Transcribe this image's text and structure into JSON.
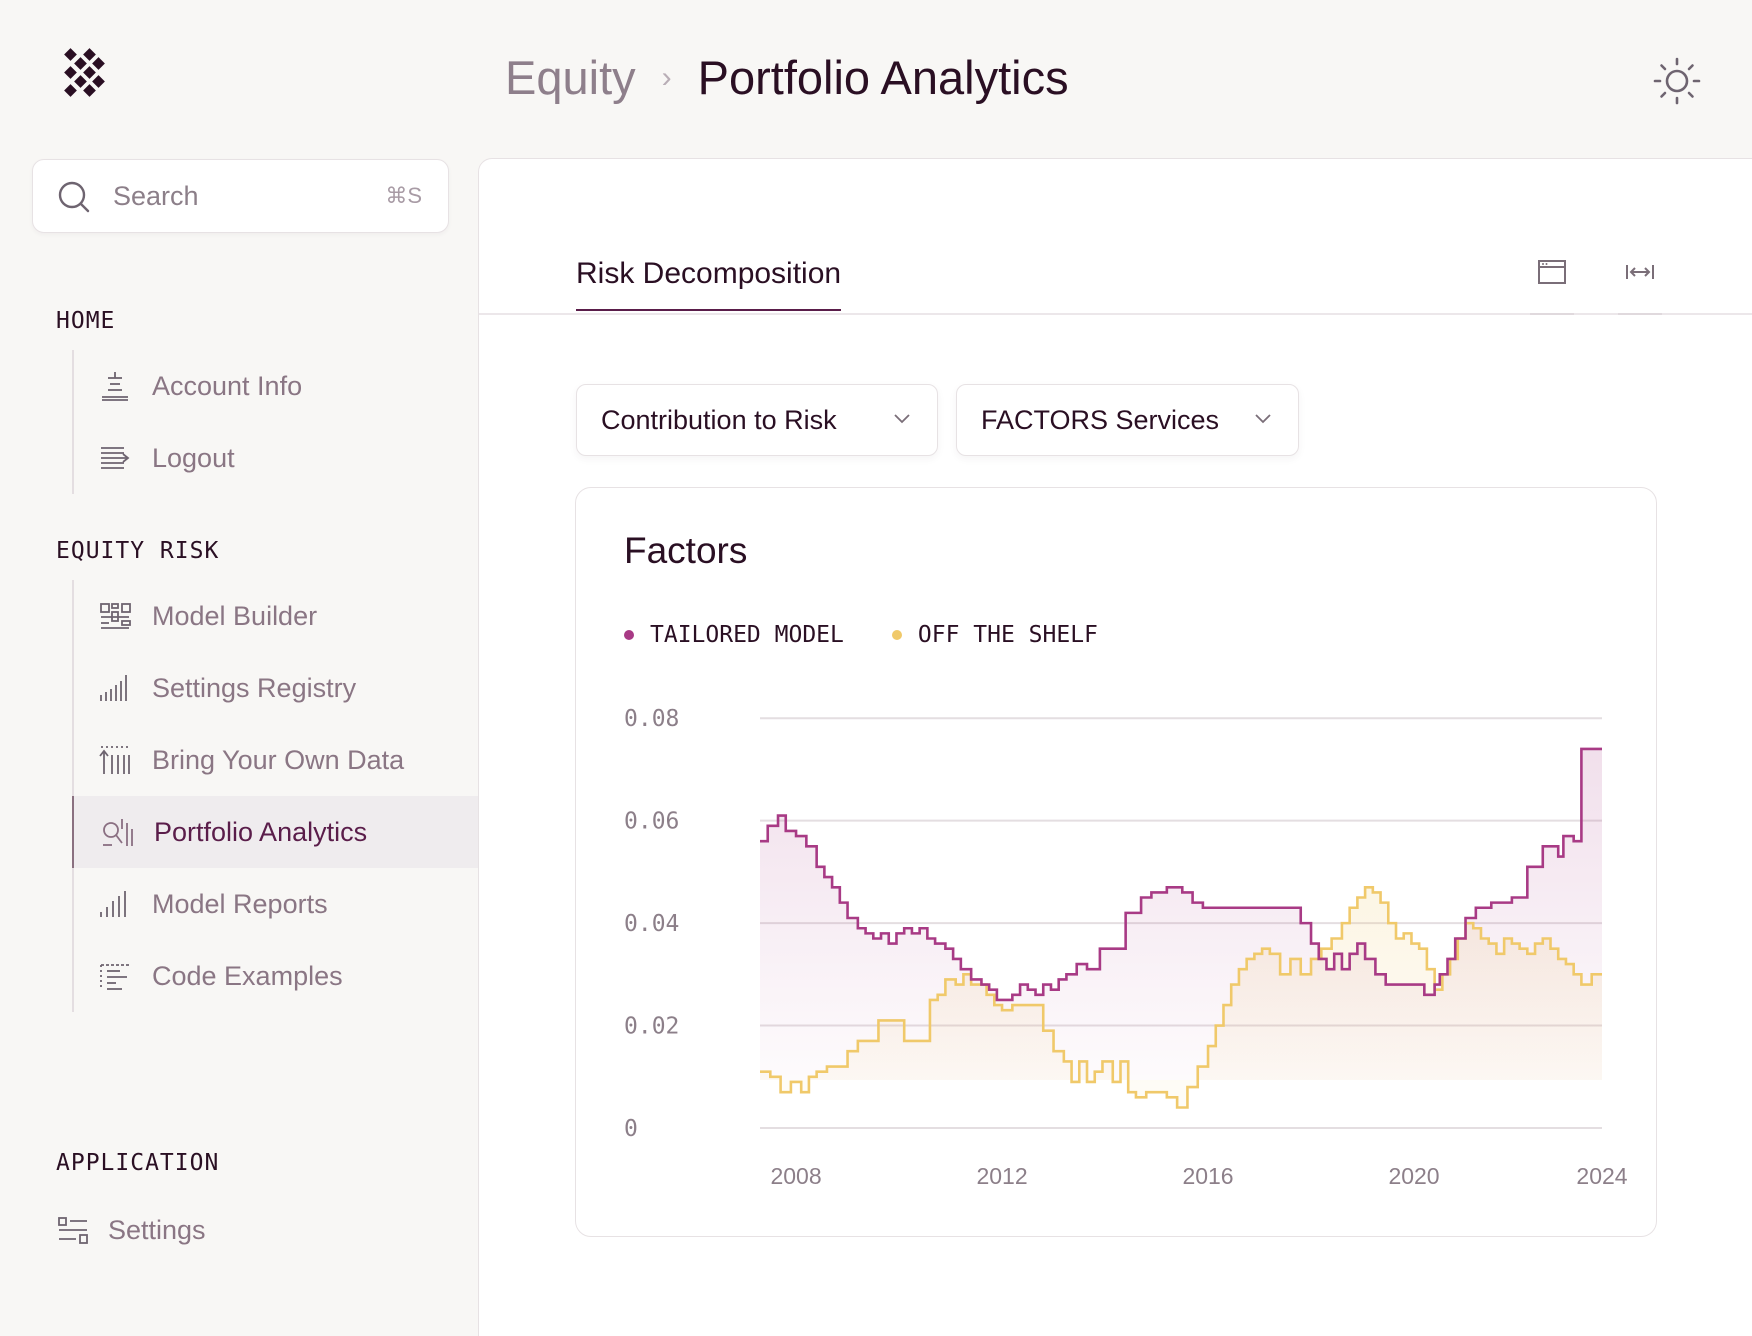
{
  "header": {
    "breadcrumb_parent": "Equity",
    "breadcrumb_separator": "›",
    "breadcrumb_current": "Portfolio Analytics"
  },
  "search": {
    "placeholder": "Search",
    "shortcut": "⌘S"
  },
  "sidebar": {
    "sections": [
      {
        "heading": "HOME",
        "items": [
          {
            "label": "Account Info",
            "icon": "account-info-icon"
          },
          {
            "label": "Logout",
            "icon": "logout-icon"
          }
        ]
      },
      {
        "heading": "EQUITY RISK",
        "items": [
          {
            "label": "Model Builder",
            "icon": "model-builder-icon"
          },
          {
            "label": "Settings Registry",
            "icon": "settings-registry-icon"
          },
          {
            "label": "Bring Your Own Data",
            "icon": "upload-data-icon"
          },
          {
            "label": "Portfolio Analytics",
            "icon": "portfolio-analytics-icon",
            "active": true
          },
          {
            "label": "Model Reports",
            "icon": "model-reports-icon"
          },
          {
            "label": "Code Examples",
            "icon": "code-examples-icon"
          }
        ]
      },
      {
        "heading": "APPLICATION",
        "items": [
          {
            "label": "Settings",
            "icon": "settings-icon"
          }
        ]
      }
    ]
  },
  "main": {
    "tabs": [
      {
        "label": "Risk Decomposition",
        "active": true
      }
    ],
    "tab_icons": [
      "window-icon",
      "expand-width-icon"
    ],
    "dropdowns": [
      {
        "label": "Contribution to Risk"
      },
      {
        "label": "FACTORS Services"
      }
    ]
  },
  "colors": {
    "accent": "#5a1d4a",
    "tailored": "#a83a85",
    "shelf": "#f0c96a"
  },
  "chart_data": {
    "type": "line",
    "title": "Factors",
    "xlabel": "",
    "ylabel": "",
    "x_ticks": [
      "2008",
      "2012",
      "2016",
      "2020",
      "2024"
    ],
    "y_ticks": [
      "0",
      "0.02",
      "0.04",
      "0.06",
      "0.08"
    ],
    "xlim": [
      2007.4,
      2023.75
    ],
    "ylim": [
      0,
      0.082
    ],
    "grid": true,
    "legend_position": "top-left",
    "step": true,
    "series": [
      {
        "name": "TAILORED MODEL",
        "color": "#a83a85",
        "x": [
          2007.4,
          2007.55,
          2007.75,
          2007.9,
          2008.1,
          2008.3,
          2008.5,
          2008.65,
          2008.8,
          2008.95,
          2009.1,
          2009.3,
          2009.45,
          2009.6,
          2009.75,
          2009.9,
          2010.05,
          2010.2,
          2010.35,
          2010.5,
          2010.65,
          2010.8,
          2011.0,
          2011.15,
          2011.3,
          2011.5,
          2011.7,
          2011.85,
          2012.0,
          2012.15,
          2012.3,
          2012.45,
          2012.6,
          2012.75,
          2012.9,
          2013.05,
          2013.2,
          2013.35,
          2013.55,
          2013.75,
          2014.0,
          2014.2,
          2014.5,
          2014.8,
          2015.0,
          2015.3,
          2015.6,
          2015.8,
          2016.0,
          2016.3,
          2016.6,
          2016.8,
          2017.0,
          2017.5,
          2017.9,
          2018.1,
          2018.25,
          2018.4,
          2018.55,
          2018.7,
          2018.85,
          2019.0,
          2019.15,
          2019.35,
          2019.55,
          2019.75,
          2019.9,
          2020.1,
          2020.3,
          2020.5,
          2020.6,
          2020.75,
          2020.9,
          2021.1,
          2021.3,
          2021.6,
          2021.8,
          2022.0,
          2022.3,
          2022.6,
          2022.9,
          2023.0,
          2023.2,
          2023.35,
          2023.55
        ],
        "values": [
          0.056,
          0.059,
          0.061,
          0.058,
          0.057,
          0.055,
          0.051,
          0.049,
          0.047,
          0.044,
          0.041,
          0.039,
          0.038,
          0.037,
          0.038,
          0.036,
          0.038,
          0.039,
          0.038,
          0.039,
          0.037,
          0.036,
          0.035,
          0.033,
          0.031,
          0.029,
          0.028,
          0.027,
          0.025,
          0.025,
          0.026,
          0.028,
          0.027,
          0.026,
          0.028,
          0.027,
          0.029,
          0.03,
          0.032,
          0.031,
          0.035,
          0.035,
          0.042,
          0.045,
          0.046,
          0.047,
          0.046,
          0.044,
          0.043,
          0.043,
          0.043,
          0.043,
          0.043,
          0.043,
          0.04,
          0.036,
          0.033,
          0.031,
          0.034,
          0.031,
          0.034,
          0.036,
          0.033,
          0.03,
          0.028,
          0.028,
          0.028,
          0.028,
          0.026,
          0.028,
          0.03,
          0.033,
          0.037,
          0.041,
          0.043,
          0.044,
          0.044,
          0.045,
          0.051,
          0.055,
          0.053,
          0.057,
          0.056,
          0.074,
          0.074
        ]
      },
      {
        "name": "OFF THE SHELF",
        "color": "#f0c96a",
        "x": [
          2007.4,
          2007.6,
          2007.8,
          2008.0,
          2008.2,
          2008.35,
          2008.5,
          2008.7,
          2008.9,
          2009.1,
          2009.3,
          2009.5,
          2009.7,
          2010.0,
          2010.2,
          2010.5,
          2010.7,
          2010.85,
          2011.0,
          2011.2,
          2011.35,
          2011.5,
          2011.65,
          2011.8,
          2011.95,
          2012.1,
          2012.3,
          2012.5,
          2012.7,
          2012.9,
          2013.1,
          2013.3,
          2013.45,
          2013.6,
          2013.75,
          2013.9,
          2014.05,
          2014.25,
          2014.4,
          2014.55,
          2014.7,
          2014.9,
          2015.1,
          2015.3,
          2015.5,
          2015.7,
          2015.9,
          2016.1,
          2016.25,
          2016.4,
          2016.55,
          2016.7,
          2016.85,
          2017.0,
          2017.15,
          2017.3,
          2017.5,
          2017.7,
          2017.9,
          2018.1,
          2018.3,
          2018.5,
          2018.7,
          2018.85,
          2019.0,
          2019.15,
          2019.3,
          2019.45,
          2019.6,
          2019.75,
          2019.9,
          2020.05,
          2020.2,
          2020.35,
          2020.5,
          2020.65,
          2020.8,
          2020.95,
          2021.1,
          2021.25,
          2021.4,
          2021.55,
          2021.7,
          2021.85,
          2022.0,
          2022.15,
          2022.3,
          2022.45,
          2022.6,
          2022.75,
          2022.9,
          2023.05,
          2023.2,
          2023.35,
          2023.55
        ],
        "values": [
          0.011,
          0.01,
          0.007,
          0.009,
          0.007,
          0.01,
          0.011,
          0.012,
          0.012,
          0.015,
          0.017,
          0.017,
          0.021,
          0.021,
          0.017,
          0.017,
          0.025,
          0.026,
          0.029,
          0.028,
          0.03,
          0.028,
          0.028,
          0.026,
          0.024,
          0.023,
          0.024,
          0.024,
          0.024,
          0.019,
          0.015,
          0.013,
          0.009,
          0.013,
          0.009,
          0.011,
          0.013,
          0.009,
          0.013,
          0.007,
          0.006,
          0.007,
          0.007,
          0.006,
          0.004,
          0.008,
          0.012,
          0.016,
          0.02,
          0.024,
          0.028,
          0.031,
          0.033,
          0.034,
          0.035,
          0.034,
          0.03,
          0.033,
          0.03,
          0.033,
          0.035,
          0.037,
          0.04,
          0.043,
          0.045,
          0.047,
          0.046,
          0.044,
          0.04,
          0.037,
          0.038,
          0.036,
          0.035,
          0.031,
          0.027,
          0.03,
          0.033,
          0.037,
          0.04,
          0.039,
          0.037,
          0.036,
          0.034,
          0.037,
          0.036,
          0.035,
          0.034,
          0.036,
          0.037,
          0.035,
          0.033,
          0.032,
          0.03,
          0.028,
          0.03
        ]
      }
    ]
  }
}
